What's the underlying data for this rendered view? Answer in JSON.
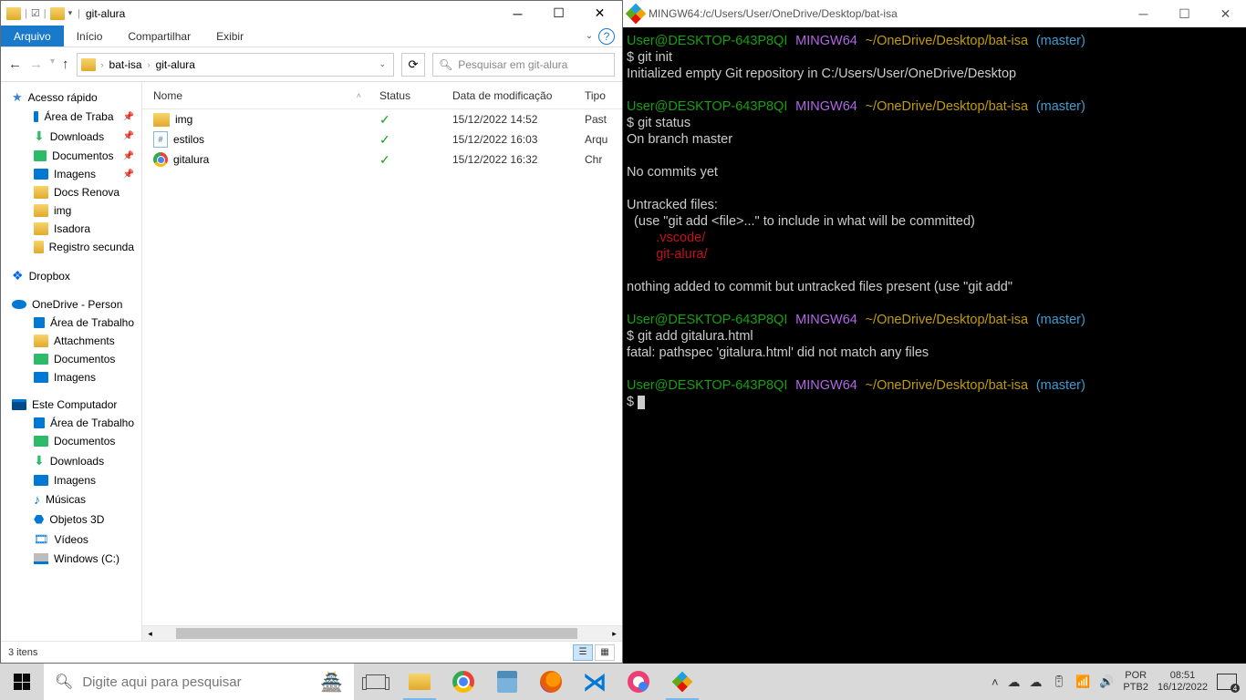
{
  "explorer": {
    "title": "git-alura",
    "tabs": {
      "file": "Arquivo",
      "home": "Início",
      "share": "Compartilhar",
      "view": "Exibir"
    },
    "address": {
      "crumbs": [
        "bat-isa",
        "git-alura"
      ]
    },
    "search": {
      "placeholder": "Pesquisar em git-alura"
    },
    "columns": {
      "name": "Nome",
      "status": "Status",
      "date": "Data de modificação",
      "type": "Tipo"
    },
    "rows": [
      {
        "icon": "folder",
        "name": "img",
        "status": "synced",
        "date": "15/12/2022 14:52",
        "type": "Past"
      },
      {
        "icon": "css",
        "name": "estilos",
        "status": "synced",
        "date": "15/12/2022 16:03",
        "type": "Arqu"
      },
      {
        "icon": "chrome",
        "name": "gitalura",
        "status": "synced",
        "date": "15/12/2022 16:32",
        "type": "Chr"
      }
    ],
    "sidebar": {
      "quick": "Acesso rápido",
      "quick_items": [
        {
          "label": "Área de Traba",
          "pin": true,
          "icon": "blue"
        },
        {
          "label": "Downloads",
          "pin": true,
          "icon": "green-down"
        },
        {
          "label": "Documentos",
          "pin": true,
          "icon": "green"
        },
        {
          "label": "Imagens",
          "pin": true,
          "icon": "blue"
        },
        {
          "label": "Docs Renova",
          "icon": "folder"
        },
        {
          "label": "img",
          "icon": "folder"
        },
        {
          "label": "Isadora",
          "icon": "folder"
        },
        {
          "label": "Registro secunda",
          "icon": "folder"
        }
      ],
      "dropbox": "Dropbox",
      "onedrive": "OneDrive - Person",
      "onedrive_items": [
        "Área de Trabalho",
        "Attachments",
        "Documentos",
        "Imagens"
      ],
      "thispc": "Este Computador",
      "pc_items": [
        {
          "label": "Área de Trabalho",
          "icon": "blue"
        },
        {
          "label": "Documentos",
          "icon": "green"
        },
        {
          "label": "Downloads",
          "icon": "green-down"
        },
        {
          "label": "Imagens",
          "icon": "blue"
        },
        {
          "label": "Músicas",
          "icon": "music"
        },
        {
          "label": "Objetos 3D",
          "icon": "cube"
        },
        {
          "label": "Vídeos",
          "icon": "video"
        },
        {
          "label": "Windows (C:)",
          "icon": "disk"
        }
      ]
    },
    "status": "3 itens"
  },
  "terminal": {
    "title": "MINGW64:/c/Users/User/OneDrive/Desktop/bat-isa",
    "prompt": {
      "user": "User@DESKTOP-643P8QI",
      "shell": "MINGW64",
      "path": "~/OneDrive/Desktop/bat-isa",
      "branch": "(master)"
    },
    "lines": {
      "l1": "$ git init",
      "l2": "Initialized empty Git repository in C:/Users/User/OneDrive/Desktop",
      "l3": "$ git status",
      "l4": "On branch master",
      "l5": "No commits yet",
      "l6": "Untracked files:",
      "l7": "  (use \"git add <file>...\" to include in what will be committed)",
      "l8a": "        .vscode/",
      "l8b": "        git-alura/",
      "l9": "nothing added to commit but untracked files present (use \"git add\"",
      "l10": "$ git add gitalura.html",
      "l11": "fatal: pathspec 'gitalura.html' did not match any files",
      "l12": "$ "
    }
  },
  "taskbar": {
    "search": "Digite aqui para pesquisar",
    "tray": {
      "lang1": "POR",
      "lang2": "PTB2",
      "time": "08:51",
      "date": "16/12/2022"
    }
  }
}
